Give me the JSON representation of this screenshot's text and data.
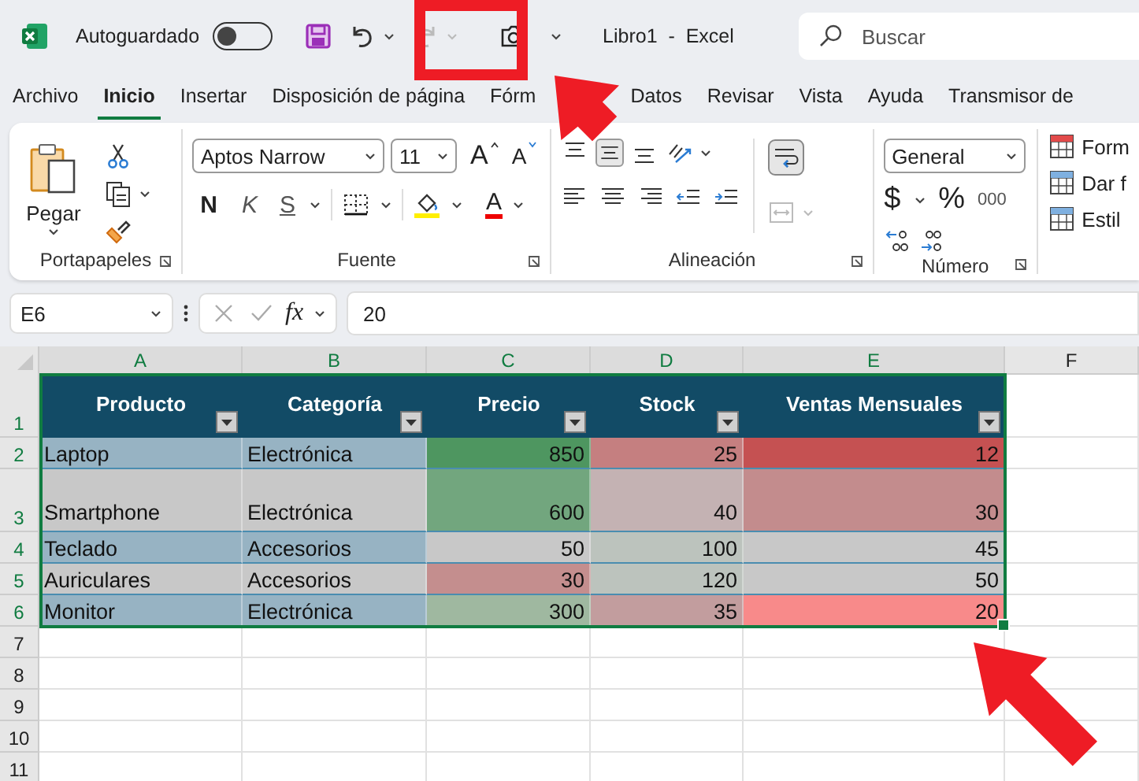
{
  "title_bar": {
    "autosave_label": "Autoguardado",
    "autosave_on": false,
    "title": "Libro1  -  Excel",
    "search_placeholder": "Buscar"
  },
  "tabs": [
    {
      "label": "Archivo",
      "selected": false
    },
    {
      "label": "Inicio",
      "selected": true
    },
    {
      "label": "Insertar",
      "selected": false
    },
    {
      "label": "Disposición de página",
      "selected": false
    },
    {
      "label": "Fórm",
      "selected": false
    },
    {
      "label": "Datos",
      "selected": false
    },
    {
      "label": "Revisar",
      "selected": false
    },
    {
      "label": "Vista",
      "selected": false
    },
    {
      "label": "Ayuda",
      "selected": false
    },
    {
      "label": "Transmisor de",
      "selected": false
    }
  ],
  "clipboard": {
    "paste": "Pegar",
    "label": "Portapapeles"
  },
  "font": {
    "family": "Aptos Narrow",
    "size": "11",
    "grow": "A",
    "shrink": "A",
    "bold": "N",
    "italic": "K",
    "underline": "S",
    "font_color": "A",
    "label": "Fuente"
  },
  "alignment": {
    "label": "Alineación"
  },
  "number": {
    "format": "General",
    "currency": "$",
    "percent": "%",
    "thousands": "000",
    "label": "Número"
  },
  "styles": [
    "Form",
    "Dar f",
    "Estil"
  ],
  "formula_bar": {
    "name_box": "E6",
    "function_label": "fx",
    "value": "20"
  },
  "sheet": {
    "columns": [
      "A",
      "B",
      "C",
      "D",
      "E",
      "F"
    ],
    "header": {
      "number": "1",
      "cells": [
        "Producto",
        "Categoría",
        "Precio",
        "Stock",
        "Ventas Mensuales"
      ]
    },
    "rows": [
      {
        "number": "2",
        "cells": [
          {
            "text": "Laptop",
            "color": "#97b3c3"
          },
          {
            "text": "Electrónica",
            "color": "#97b3c3"
          },
          {
            "text": "850",
            "color": "#4e9660"
          },
          {
            "text": "25",
            "color": "#c57f80"
          },
          {
            "text": "12",
            "color": "#c55152"
          }
        ]
      },
      {
        "number": "3",
        "cells": [
          {
            "text": "Smartphone",
            "color": "#c8c8c8"
          },
          {
            "text": "Electrónica",
            "color": "#c8c8c8"
          },
          {
            "text": "600",
            "color": "#72a67e"
          },
          {
            "text": "40",
            "color": "#c4b2b3"
          },
          {
            "text": "30",
            "color": "#c38c8d"
          }
        ]
      },
      {
        "number": "4",
        "cells": [
          {
            "text": "Teclado",
            "color": "#97b3c3"
          },
          {
            "text": "Accesorios",
            "color": "#97b3c3"
          },
          {
            "text": "50",
            "color": "#c8c8c8"
          },
          {
            "text": "100",
            "color": "#bcc3bd"
          },
          {
            "text": "45",
            "color": "#c8c8c8"
          }
        ]
      },
      {
        "number": "5",
        "cells": [
          {
            "text": "Auriculares",
            "color": "#c8c8c8"
          },
          {
            "text": "Accesorios",
            "color": "#c8c8c8"
          },
          {
            "text": "30",
            "color": "#c48e8e"
          },
          {
            "text": "120",
            "color": "#bcc3bd"
          },
          {
            "text": "50",
            "color": "#c8c8c8"
          }
        ]
      },
      {
        "number": "6",
        "cells": [
          {
            "text": "Monitor",
            "color": "#97b3c3"
          },
          {
            "text": "Electrónica",
            "color": "#97b3c3"
          },
          {
            "text": "300",
            "color": "#9fb8a0"
          },
          {
            "text": "35",
            "color": "#c29d9e"
          },
          {
            "text": "20",
            "color": "#f88a8a"
          }
        ]
      }
    ],
    "empty_rows": [
      "7",
      "8",
      "9",
      "10",
      "11"
    ]
  }
}
